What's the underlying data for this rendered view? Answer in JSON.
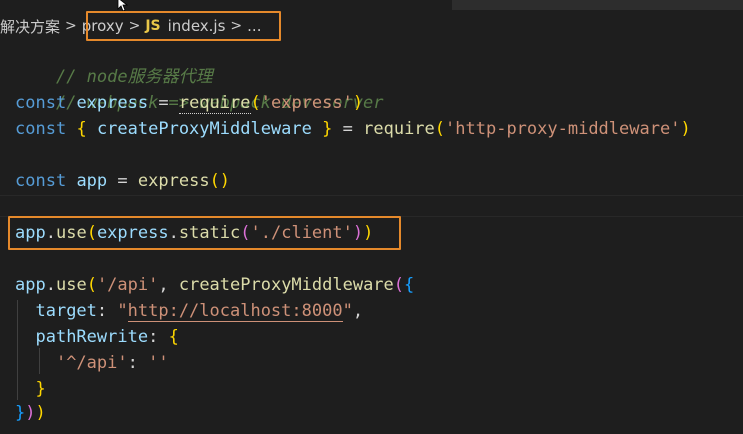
{
  "breadcrumb": {
    "parent": "解决方案",
    "folder": "proxy",
    "file_icon": "JS",
    "file": "index.js",
    "more": "...",
    "separator": ">"
  },
  "code": {
    "line1": "// node服务器代理",
    "line2": "// webpack => webpack-dev-server",
    "line3": {
      "kw": "const",
      "var": "express",
      "eq": "=",
      "fn": "require",
      "arg": "'express'"
    },
    "line4": {
      "kw": "const",
      "var": "createProxyMiddleware",
      "eq": "=",
      "fn": "require",
      "arg": "'http-proxy-middleware'"
    },
    "line6": {
      "kw": "const",
      "var": "app",
      "eq": "=",
      "fn": "express"
    },
    "line8": {
      "obj": "app",
      "method": "use",
      "inner_obj": "express",
      "inner_fn": "static",
      "arg": "'./client'"
    },
    "line10": {
      "obj": "app",
      "method": "use",
      "path": "'/api'",
      "fn": "createProxyMiddleware"
    },
    "line11": {
      "key": "target",
      "value_open": "\"",
      "value": "http://localhost:8000",
      "value_close": "\""
    },
    "line12": {
      "key": "pathRewrite"
    },
    "line13": {
      "key": "'^/api'",
      "value": "''"
    }
  },
  "colors": {
    "keyword": "#569cd6",
    "variable": "#9cdcfe",
    "function": "#dcdcaa",
    "string": "#ce9178",
    "comment": "#6a9955",
    "highlight_box": "#e5892b"
  }
}
